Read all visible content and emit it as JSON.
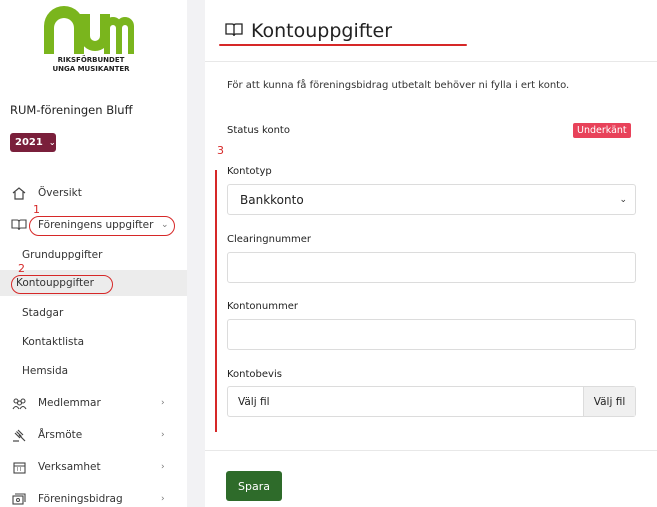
{
  "logo": {
    "line1": "RIKSFÖRBUNDET",
    "line2": "UNGA MUSIKANTER"
  },
  "organization": "RUM-föreningen Bluff",
  "year": "2021",
  "sidebar": {
    "items": [
      {
        "label": "Översikt",
        "icon": "home-icon"
      },
      {
        "label": "Föreningens uppgifter",
        "icon": "book-icon",
        "expanded": true
      },
      {
        "label": "Medlemmar",
        "icon": "members-icon"
      },
      {
        "label": "Årsmöte",
        "icon": "gavel-icon"
      },
      {
        "label": "Verksamhet",
        "icon": "calendar-icon"
      },
      {
        "label": "Föreningsbidrag",
        "icon": "money-icon"
      }
    ],
    "subitems": [
      {
        "label": "Grunduppgifter"
      },
      {
        "label": "Kontouppgifter",
        "active": true
      },
      {
        "label": "Stadgar"
      },
      {
        "label": "Kontaktlista"
      },
      {
        "label": "Hemsida"
      }
    ]
  },
  "annotations": {
    "n1": "1",
    "n2": "2",
    "n3": "3"
  },
  "main": {
    "title": "Kontouppgifter",
    "title_icon": "book-icon",
    "intro": "För att kunna få föreningsbidrag utbetalt behöver ni fylla i ert konto.",
    "status_label": "Status konto",
    "status_badge": "Underkänt",
    "account_type_label": "Kontotyp",
    "account_type_value": "Bankkonto",
    "clearing_label": "Clearingnummer",
    "clearing_value": "",
    "account_number_label": "Kontonummer",
    "account_number_value": "",
    "proof_label": "Kontobevis",
    "file_placeholder": "Välj fil",
    "file_button": "Välj fil",
    "save_label": "Spara"
  },
  "colors": {
    "brand_green": "#7ab51d",
    "year_bg": "#7a1f3b",
    "badge_bg": "#e8425a",
    "save_bg": "#2e6b2a",
    "annotation": "#d62828"
  }
}
